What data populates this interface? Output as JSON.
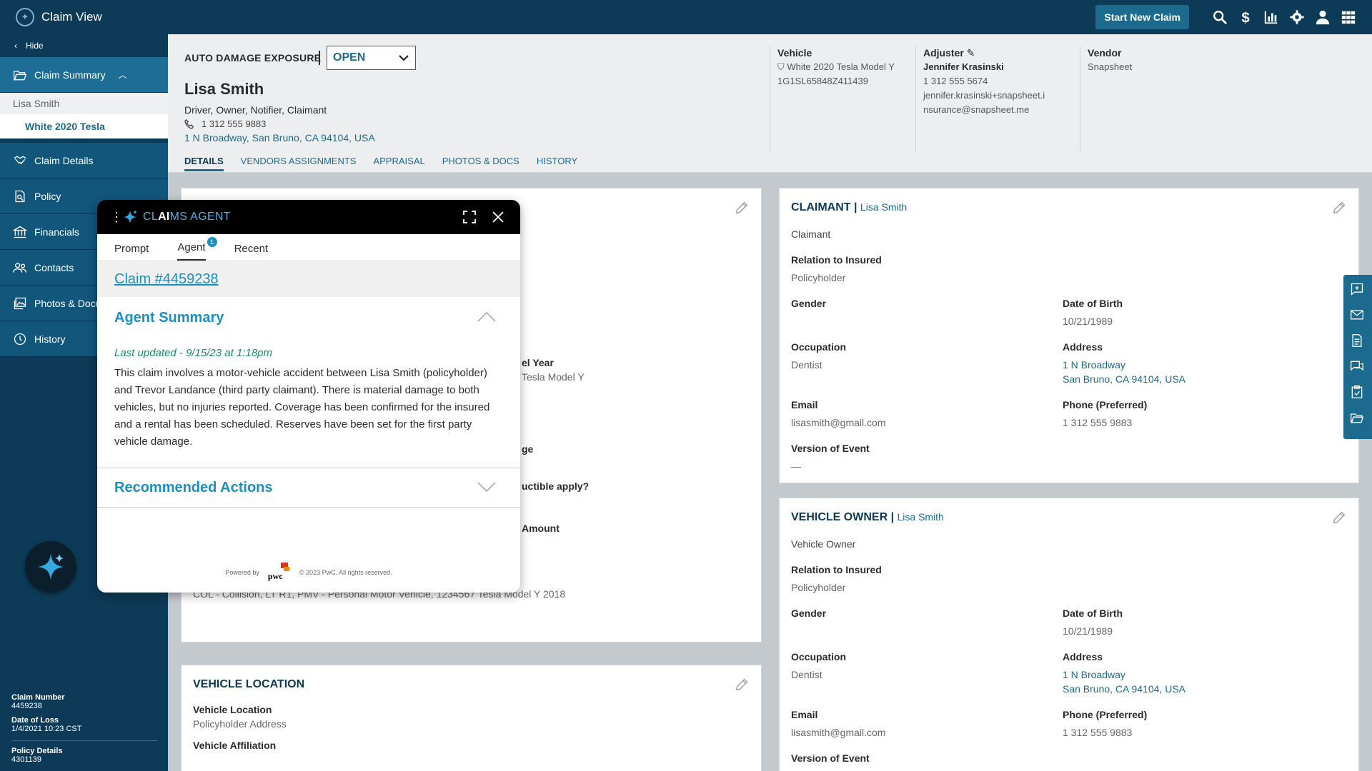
{
  "app": {
    "title": "Claim View"
  },
  "topbar": {
    "new_claim_label": "Start New Claim"
  },
  "sidebar": {
    "hide_label": "Hide",
    "summary_label": "Claim Summary",
    "sub_name": "Lisa Smith",
    "sub_vehicle": "White 2020 Tesla",
    "items": [
      {
        "label": "Claim Details"
      },
      {
        "label": "Policy"
      },
      {
        "label": "Financials"
      },
      {
        "label": "Contacts"
      },
      {
        "label": "Photos & Documents"
      },
      {
        "label": "History"
      }
    ],
    "meta": {
      "claim_number_label": "Claim Number",
      "claim_number": "4459238",
      "date_of_loss_label": "Date of Loss",
      "date_of_loss": "1/4/2021 10:23 CST",
      "policy_details_label": "Policy Details",
      "policy_details": "4301139"
    }
  },
  "header": {
    "exposure_label": "AUTO DAMAGE EXPOSURE",
    "status": "OPEN",
    "party_name": "Lisa Smith",
    "party_roles": "Driver, Owner, Notifier, Claimant",
    "party_phone": "1 312 555 9883",
    "party_address": "1 N Broadway, San Bruno, CA 94104, USA",
    "tabs": [
      "DETAILS",
      "VENDORS ASSIGNMENTS",
      "APPRAISAL",
      "PHOTOS & DOCS",
      "HISTORY"
    ],
    "vehicle": {
      "heading": "Vehicle",
      "desc": "White 2020 Tesla Model Y",
      "vin": "1G1SL65848Z411439"
    },
    "adjuster": {
      "heading": "Adjuster",
      "name": "Jennifer Krasinski",
      "phone": "1 312 555 5674",
      "email_1": "jennifer.krasinski+snapsheet.i",
      "email_2": "nsurance@snapsheet.me"
    },
    "vendor": {
      "heading": "Vendor",
      "name": "Snapsheet"
    }
  },
  "left_card": {
    "model_year_label": "el Year",
    "model_year_value": "Tesla Model Y",
    "coverage_label": "ge",
    "deductible_label": "uctible apply?",
    "amount_label": "Amount",
    "coverage_line": "COL - Collision, LT R1, PMV - Personal Motor Vehicle, 1234567 Tesla Model Y 2018"
  },
  "vehicle_location": {
    "title": "VEHICLE LOCATION",
    "location_label": "Vehicle Location",
    "location_value": "Policyholder Address",
    "affiliation_label": "Vehicle Affiliation"
  },
  "claimant_card": {
    "title": "CLAIMANT",
    "title_sub": "Lisa Smith",
    "role": "Claimant",
    "relation_label": "Relation to Insured",
    "relation_value": "Policyholder",
    "gender_label": "Gender",
    "dob_label": "Date of Birth",
    "dob_value": "10/21/1989",
    "occupation_label": "Occupation",
    "occupation_value": "Dentist",
    "address_label": "Address",
    "address_1": "1 N Broadway",
    "address_2": "San Bruno, CA 94104, USA",
    "email_label": "Email",
    "email_value": "lisasmith@gmail.com",
    "phone_label": "Phone (Preferred)",
    "phone_value": "1 312 555 9883",
    "version_label": "Version of Event",
    "version_value": "—"
  },
  "owner_card": {
    "title": "VEHICLE OWNER",
    "title_sub": "Lisa Smith",
    "role": "Vehicle Owner",
    "relation_label": "Relation to Insured",
    "relation_value": "Policyholder",
    "gender_label": "Gender",
    "dob_label": "Date of Birth",
    "dob_value": "10/21/1989",
    "occupation_label": "Occupation",
    "occupation_value": "Dentist",
    "address_label": "Address",
    "address_1": "1 N Broadway",
    "address_2": "San Bruno, CA 94104, USA",
    "email_label": "Email",
    "email_value": "lisasmith@gmail.com",
    "phone_label": "Phone (Preferred)",
    "phone_value": "1 312 555 9883",
    "version_label": "Version of Event"
  },
  "agent": {
    "title_pre": "CL",
    "title_ai": "AI",
    "title_post": "MS AGENT",
    "tabs": [
      "Prompt",
      "Agent",
      "Recent"
    ],
    "agent_badge": "1",
    "claim_link": "Claim #4459238",
    "summary_title": "Agent Summary",
    "last_updated": "Last updated - 9/15/23 at 1:18pm",
    "summary_text": "This claim involves a motor-vehicle accident between Lisa Smith (policyholder) and Trevor Landance (third party claimant). There is material damage to both vehicles, but no injuries reported. Coverage has been confirmed for the insured and a rental has been scheduled. Reserves have been set for the first party vehicle damage.",
    "recommended_title": "Recommended Actions",
    "powered_by": "Powered by",
    "pwc": "pwc",
    "copyright": "© 2023 PwC. All rights reserved."
  },
  "colors": {
    "navy": "#0d3a56",
    "accent": "#1c6b8e",
    "agent_blue": "#1c8fc0"
  }
}
